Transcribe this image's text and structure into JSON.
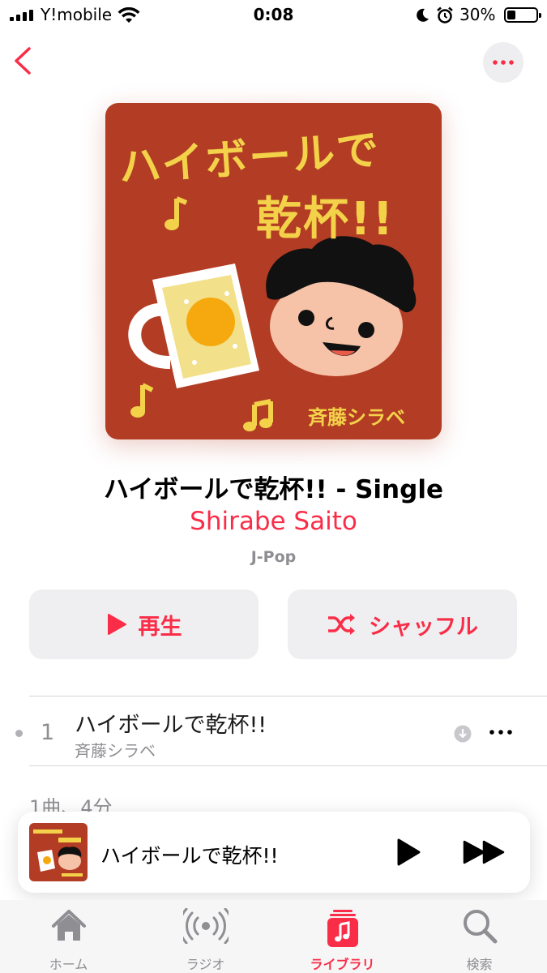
{
  "status_bar": {
    "carrier": "Y!mobile",
    "time": "0:08",
    "battery": "30%"
  },
  "album": {
    "title": "ハイボールで乾杯!! - Single",
    "artist": "Shirabe Saito",
    "genre": "J-Pop",
    "art_text_line1": "ハイボールで",
    "art_text_line2": "乾杯!!",
    "art_text_artist": "斉藤シラベ"
  },
  "buttons": {
    "play": "再生",
    "shuffle": "シャッフル"
  },
  "tracks": [
    {
      "number": "1",
      "title": "ハイボールで乾杯!!",
      "artist": "斉藤シラベ"
    }
  ],
  "summary": "1曲、4分",
  "mini_player": {
    "title": "ハイボールで乾杯!!"
  },
  "tabs": [
    {
      "label": "ホーム",
      "icon": "home-icon"
    },
    {
      "label": "ラジオ",
      "icon": "radio-icon"
    },
    {
      "label": "ライブラリ",
      "icon": "library-icon",
      "active": true
    },
    {
      "label": "検索",
      "icon": "search-icon"
    }
  ],
  "colors": {
    "accent": "#fa2d48",
    "art_background": "#b33c24",
    "art_text": "#f3d24a"
  }
}
